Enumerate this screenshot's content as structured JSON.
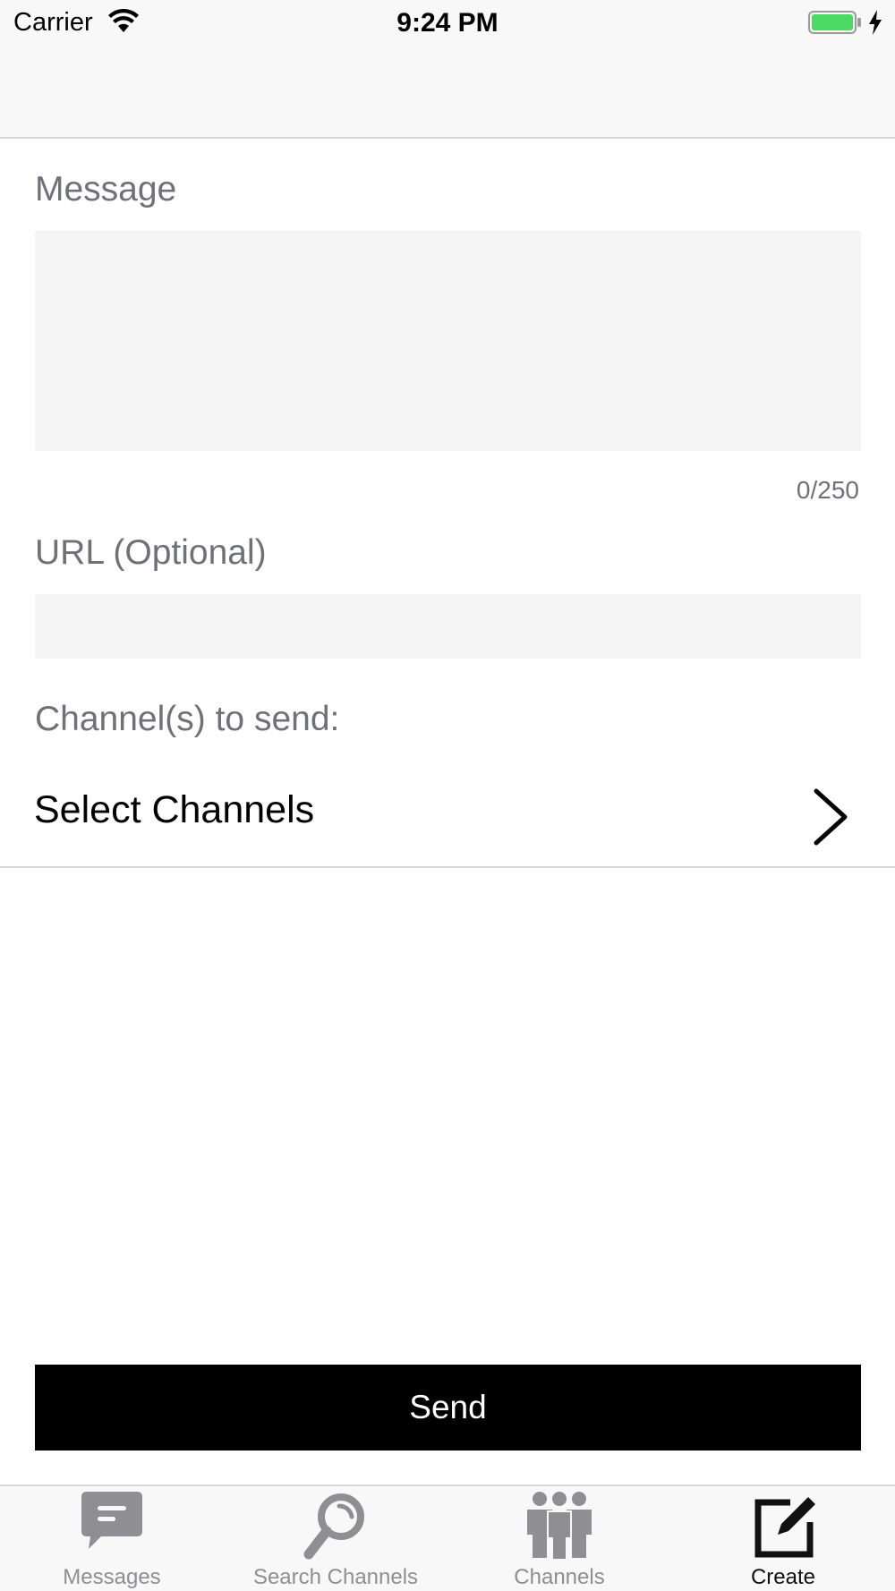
{
  "status_bar": {
    "carrier": "Carrier",
    "time": "9:24 PM",
    "battery_color": "#4cd964"
  },
  "form": {
    "message_label": "Message",
    "message_value": "",
    "counter": "0/250",
    "url_label": "URL (Optional)",
    "url_value": "",
    "channels_label": "Channel(s) to send:",
    "select_channels": "Select Channels",
    "send_label": "Send"
  },
  "tab_bar": {
    "tabs": [
      {
        "label": "Messages",
        "icon": "chat-bubble-icon",
        "active": false
      },
      {
        "label": "Search Channels",
        "icon": "magnifier-icon",
        "active": false
      },
      {
        "label": "Channels",
        "icon": "people-group-icon",
        "active": false
      },
      {
        "label": "Create",
        "icon": "compose-icon",
        "active": true
      }
    ],
    "inactive_color": "#8e8e93",
    "active_color": "#111111"
  }
}
